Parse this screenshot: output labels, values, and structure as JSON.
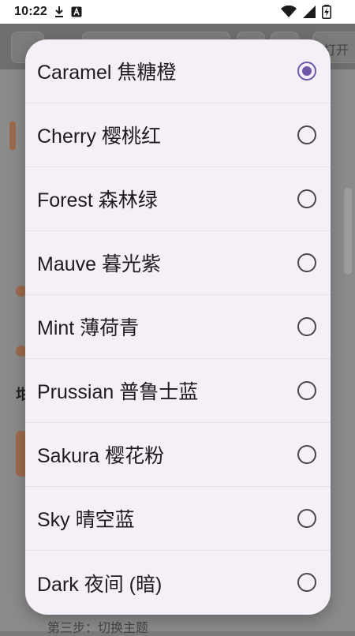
{
  "status_bar": {
    "time": "10:22"
  },
  "background": {
    "toolbar_open_text": "打开 n",
    "bottom_text": "第三步：切换主题"
  },
  "theme_dialog": {
    "selected_index": 0,
    "options": [
      {
        "label": "Caramel 焦糖橙",
        "selected": true
      },
      {
        "label": "Cherry 樱桃红",
        "selected": false
      },
      {
        "label": "Forest 森林绿",
        "selected": false
      },
      {
        "label": "Mauve 暮光紫",
        "selected": false
      },
      {
        "label": "Mint 薄荷青",
        "selected": false
      },
      {
        "label": "Prussian 普鲁士蓝",
        "selected": false
      },
      {
        "label": "Sakura 樱花粉",
        "selected": false
      },
      {
        "label": "Sky 晴空蓝",
        "selected": false
      },
      {
        "label": "Dark 夜间 (暗)",
        "selected": false
      }
    ]
  },
  "colors": {
    "accent": "#6f58a8",
    "dialog_bg": "#f5eff7",
    "scrim": "#7a7a7a"
  }
}
